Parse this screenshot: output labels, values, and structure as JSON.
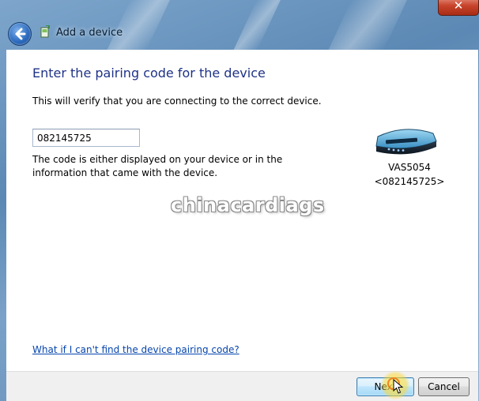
{
  "window": {
    "title": "Add a device",
    "close_label": "✕"
  },
  "page": {
    "heading": "Enter the pairing code for the device",
    "description": "This will verify that you are connecting to the correct device.",
    "code_value": "082145725",
    "hint": "The code is either displayed on your device or in the information that came with the device.",
    "help_link": "What if I can't find the device pairing code?"
  },
  "device": {
    "name": "VAS5054",
    "code": "<082145725>"
  },
  "watermark": "chinacardiags",
  "buttons": {
    "next": "Next",
    "cancel": "Cancel"
  },
  "icons": {
    "back": "back-arrow-icon",
    "wizard": "add-device-icon",
    "device": "device-icon",
    "cursor": "mouse-pointer-icon"
  },
  "colors": {
    "heading": "#1e3287",
    "link": "#0645ad",
    "close_button": "#c8442c"
  }
}
